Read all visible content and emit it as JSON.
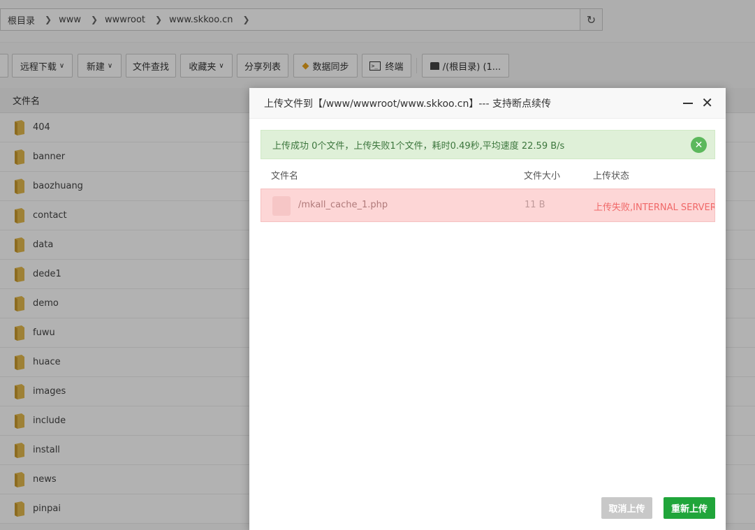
{
  "breadcrumb": [
    "根目录",
    "www",
    "wwwroot",
    "www.skkoo.cn"
  ],
  "toolbar": {
    "remote_download": "远程下载",
    "new": "新建",
    "file_search": "文件查找",
    "favorites": "收藏夹",
    "share_list": "分享列表",
    "data_sync": "数据同步",
    "terminal": "终端",
    "disk": "/(根目录) (1..."
  },
  "file_list": {
    "header": "文件名",
    "items": [
      "404",
      "banner",
      "baozhuang",
      "contact",
      "data",
      "dede1",
      "demo",
      "fuwu",
      "huace",
      "images",
      "include",
      "install",
      "news",
      "pinpai"
    ]
  },
  "modal": {
    "title": "上传文件到【/www/wwwroot/www.skkoo.cn】--- 支持断点续传",
    "success_message": "上传成功 0个文件，上传失败1个文件，耗时0.49秒,平均速度 22.59 B/s",
    "columns": {
      "name": "文件名",
      "size": "文件大小",
      "status": "上传状态"
    },
    "rows": [
      {
        "name": "/mkall_cache_1.php",
        "size": "11 B",
        "status": "上传失败,INTERNAL SERVER ERROR"
      }
    ],
    "cancel_label": "取消上传",
    "retry_label": "重新上传"
  },
  "colors": {
    "accent_green": "#20a53a",
    "success_bg": "#dff0d8",
    "error_bg": "#fdd6d6",
    "error_text": "#f06868"
  }
}
